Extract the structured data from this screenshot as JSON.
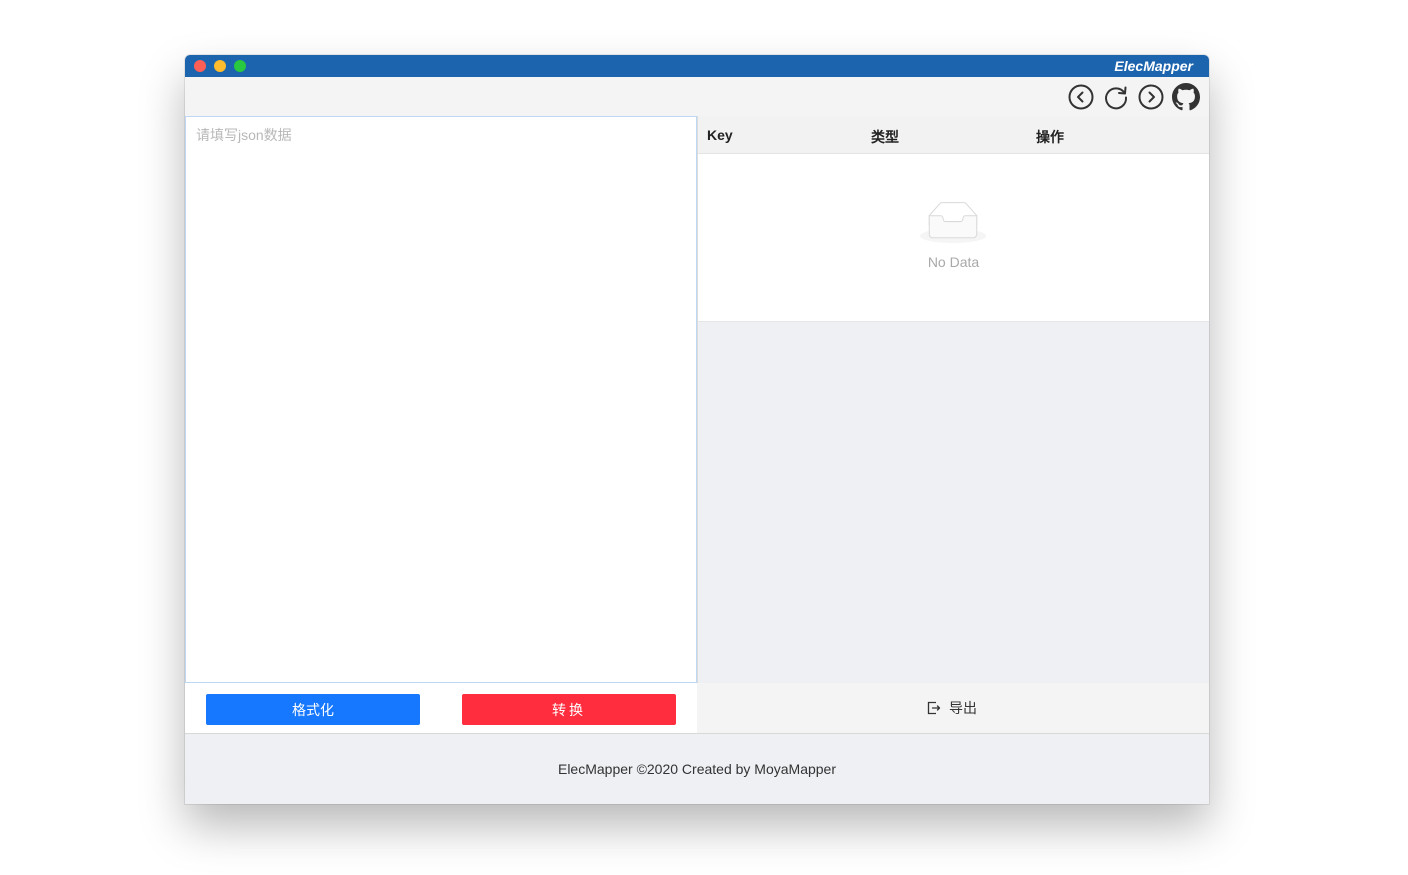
{
  "window": {
    "title": "ElecMapper"
  },
  "toolbar": {
    "icons": [
      "arrow-left-circle-icon",
      "refresh-icon",
      "arrow-right-circle-icon",
      "github-icon"
    ]
  },
  "editor": {
    "placeholder": "请填写json数据",
    "value": ""
  },
  "table": {
    "columns": [
      "Key",
      "类型",
      "操作"
    ],
    "rows": [],
    "empty_text": "No Data"
  },
  "actions": {
    "format_label": "格式化",
    "convert_label": "转换",
    "export_label": "导出"
  },
  "footer": {
    "text": "ElecMapper ©2020 Created by MoyaMapper"
  },
  "colors": {
    "titlebar": "#1c64ad",
    "format_button": "#1677ff",
    "convert_button": "#ff2d3e"
  }
}
